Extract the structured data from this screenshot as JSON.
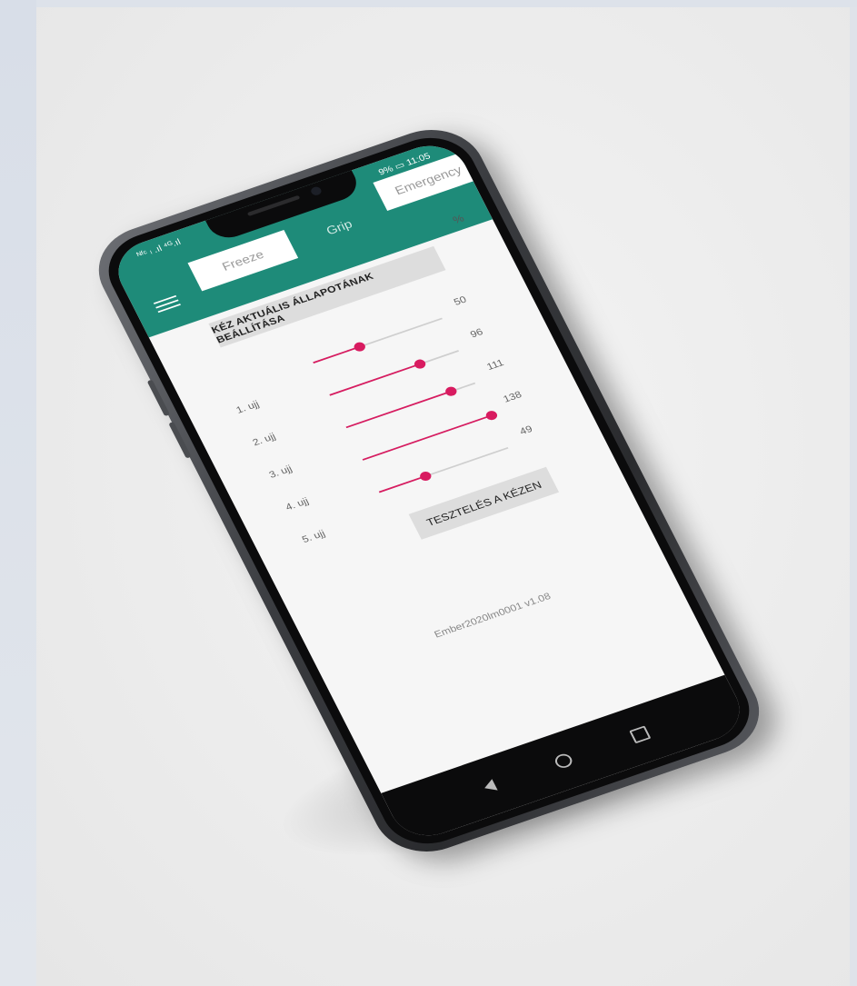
{
  "status": {
    "left": "ᴺᶠᶜ ₗ .ıl ⁴ᴳ.ıl",
    "right": "9% ▭ 11:05"
  },
  "tabs": {
    "freeze": "Freeze",
    "grip": "Grip",
    "emergency": "Emergency"
  },
  "percent_symbol": "%",
  "title": "KÉZ AKTUÁLIS ÁLLAPOTÁNAK BEÁLLÍTÁSA",
  "sliders": [
    {
      "label": "1. ujj",
      "value": "50",
      "fraction": 0.36
    },
    {
      "label": "2. ujj",
      "value": "96",
      "fraction": 0.7
    },
    {
      "label": "3. ujj",
      "value": "111",
      "fraction": 0.81
    },
    {
      "label": "4. ujj",
      "value": "138",
      "fraction": 1.0
    },
    {
      "label": "5. ujj",
      "value": "49",
      "fraction": 0.36
    }
  ],
  "test_button": "TESZTELÉS A KÉZEN",
  "version": "Ember2020lm0001 v1.08",
  "accent_color": "#d81b60",
  "header_color": "#1e8b79",
  "icons": [
    "menu-icon",
    "back-icon",
    "home-icon",
    "recent-apps-icon"
  ]
}
